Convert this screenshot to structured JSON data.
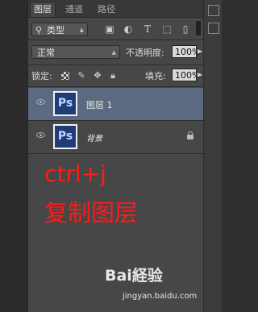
{
  "tabs": [
    {
      "label": "图层",
      "active": true
    },
    {
      "label": "通道",
      "active": false
    },
    {
      "label": "路径",
      "active": false
    }
  ],
  "filter": {
    "kind_label": "类型",
    "icons": [
      "image-filter-icon",
      "adjustment-filter-icon",
      "type-filter-icon",
      "shape-filter-icon",
      "smart-object-filter-icon"
    ]
  },
  "blend": {
    "mode": "正常",
    "opacity_label": "不透明度:",
    "opacity_value": "100%"
  },
  "lock": {
    "label": "锁定:",
    "fill_label": "填充:",
    "fill_value": "100%"
  },
  "layers": [
    {
      "name": "图层 1",
      "thumb": "Ps",
      "selected": true,
      "locked": false
    },
    {
      "name": "背景",
      "thumb": "Ps",
      "selected": false,
      "locked": true
    }
  ],
  "annotation": {
    "line1": "ctrl+j",
    "line2": "复制图层",
    "color": "#ff1a1a"
  },
  "watermark": {
    "brand": "Bai経验",
    "url": "jingyan.baidu.com"
  }
}
